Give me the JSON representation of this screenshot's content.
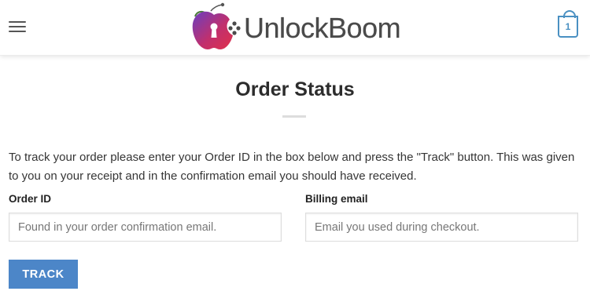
{
  "header": {
    "menu_icon": "hamburger-menu-icon",
    "logo_text": "UnlockBoom",
    "cart_icon": "shopping-bag-icon",
    "cart_count": "1",
    "accent_color": "#4a90c2"
  },
  "main": {
    "title": "Order Status",
    "intro": "To track your order please enter your Order ID in the box below and press the \"Track\" button. This was given to you on your receipt and in the confirmation email you should have received.",
    "order_id": {
      "label": "Order ID",
      "value": "",
      "placeholder": "Found in your order confirmation email."
    },
    "billing_email": {
      "label": "Billing email",
      "value": "",
      "placeholder": "Email you used during checkout."
    },
    "track_label": "Track",
    "button_color": "#4c86c8"
  }
}
